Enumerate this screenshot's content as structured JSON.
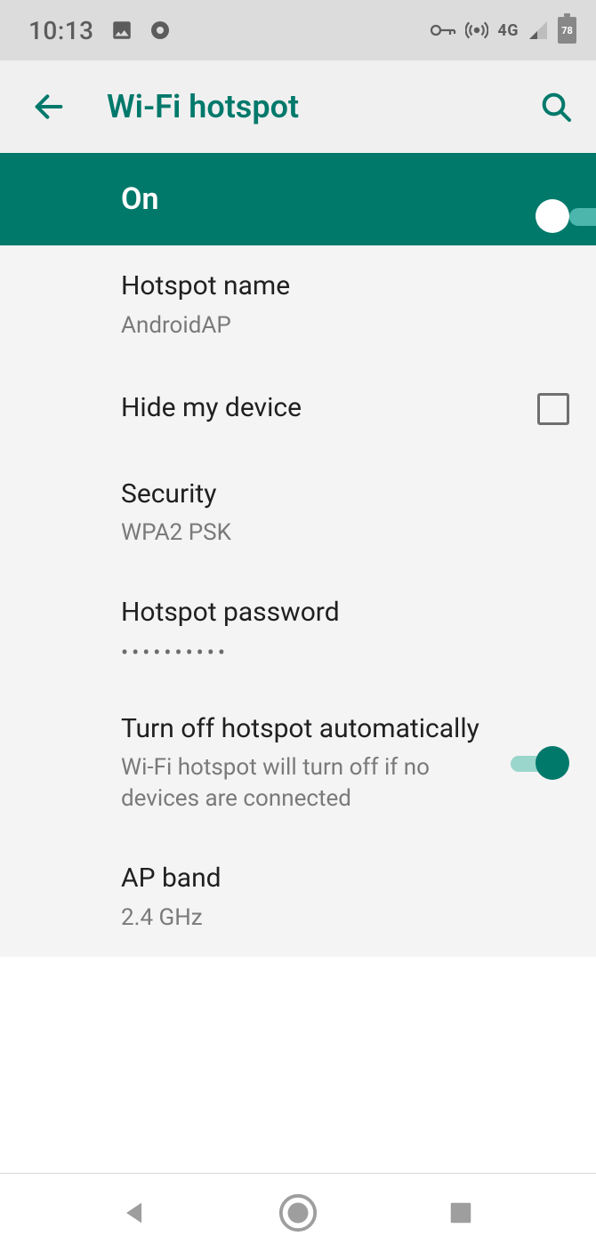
{
  "status": {
    "time": "10:13",
    "network_label": "4G",
    "battery_text": "78"
  },
  "appbar": {
    "title": "Wi-Fi hotspot"
  },
  "master": {
    "label": "On",
    "enabled": true
  },
  "rows": {
    "hotspot_name": {
      "title": "Hotspot name",
      "value": "AndroidAP"
    },
    "hide_device": {
      "title": "Hide my device",
      "checked": false
    },
    "security": {
      "title": "Security",
      "value": "WPA2 PSK"
    },
    "password": {
      "title": "Hotspot password",
      "mask": "••••••••••"
    },
    "auto_off": {
      "title": "Turn off hotspot automatically",
      "desc": "Wi-Fi hotspot will turn off if no devices are connected",
      "enabled": true
    },
    "ap_band": {
      "title": "AP band",
      "value": "2.4 GHz"
    }
  }
}
